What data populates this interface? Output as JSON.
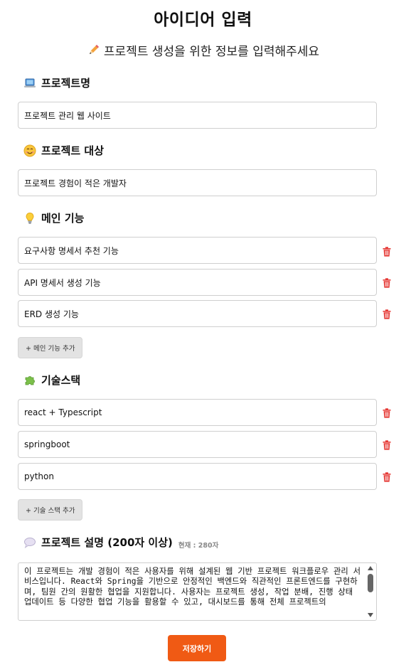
{
  "header": {
    "title": "아이디어 입력",
    "subtitle": "프로젝트 생성을 위한 정보를 입력해주세요"
  },
  "project_name": {
    "label": "프로젝트명",
    "icon": "laptop-icon",
    "value": "프로젝트 관리 웹 사이트"
  },
  "project_target": {
    "label": "프로젝트 대상",
    "icon": "smiley-icon",
    "value": "프로젝트 경험이 적은 개발자"
  },
  "main_features": {
    "label": "메인 기능",
    "icon": "lightbulb-icon",
    "items": [
      "요구사항 명세서 추천 기능",
      "API 명세서 생성 기능",
      "ERD 생성 기능"
    ],
    "add_label": "+ 메인 기능 추가"
  },
  "tech_stack": {
    "label": "기술스택",
    "icon": "puzzle-icon",
    "items": [
      "react + Typescript",
      "springboot",
      "python"
    ],
    "add_label": "+ 기술 스택 추가"
  },
  "description": {
    "label": "프로젝트 설명 (200자 이상)",
    "icon": "speech-bubble-icon",
    "counter": "현재 : 280자",
    "value": "이 프로젝트는 개발 경험이 적은 사용자를 위해 설계된 웹 기반 프로젝트 워크플로우 관리 서비스입니다. React와 Spring을 기반으로 안정적인 백엔드와 직관적인 프론트엔드를 구현하며, 팀원 간의 원활한 협업을 지원합니다. 사용자는 프로젝트 생성, 작업 분배, 진행 상태 업데이트 등 다양한 협업 기능을 활용할 수 있고, 대시보드를 통해 전체 프로젝트의"
  },
  "save_label": "저장하기",
  "colors": {
    "accent": "#f05a14",
    "delete": "#e53935"
  }
}
